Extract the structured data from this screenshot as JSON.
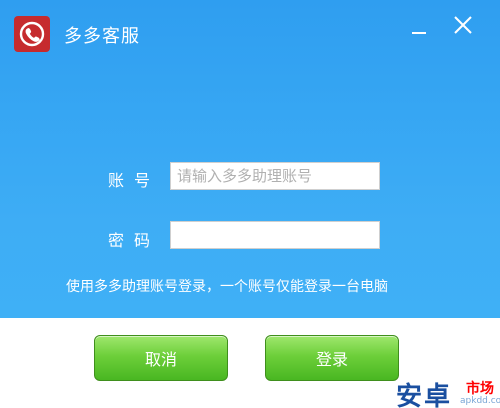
{
  "window": {
    "title": "多多客服"
  },
  "login_form": {
    "account_label": "账号",
    "account_placeholder": "请输入多多助理账号",
    "account_value": "",
    "password_label": "密码",
    "password_value": "",
    "notice": "使用多多助理账号登录，一个账号仅能登录一台电脑",
    "cancel_label": "取消",
    "login_label": "登录"
  },
  "watermark": {
    "main": "安卓",
    "badge": "市场",
    "url": "apkdd.com"
  },
  "icons": [
    "app-logo-icon",
    "minimize-icon",
    "close-icon"
  ],
  "colors": {
    "header_blue": "#3fb0f6",
    "button_green": "#6dcf3a",
    "logo_red": "#c62b2e"
  }
}
